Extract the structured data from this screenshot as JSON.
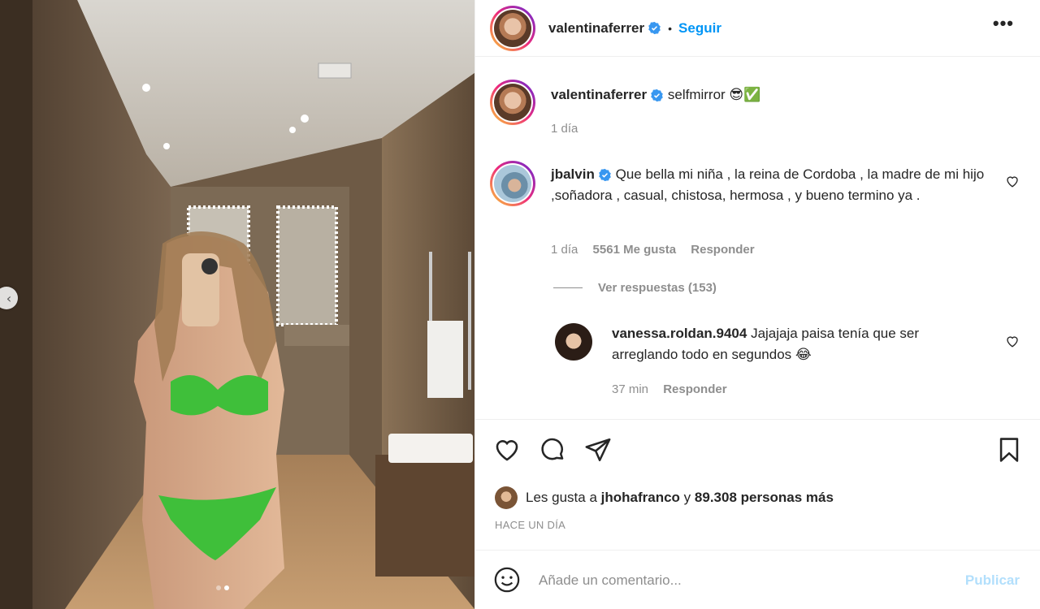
{
  "post": {
    "author": "valentinaferrer",
    "follow_label": "Seguir",
    "separator": "•",
    "more_label": "•••",
    "carousel_prev": "‹"
  },
  "caption": {
    "username": "valentinaferrer",
    "text": "selfmirror 😎✅",
    "time": "1 día"
  },
  "comments": [
    {
      "username": "jbalvin",
      "text": "Que bella mi niña , la reina de Cordoba , la madre de mi hijo ,soñadora , casual, chistosa, hermosa , y bueno termino ya .",
      "time": "1 día",
      "likes": "5561 Me gusta",
      "reply": "Responder",
      "view_replies": "Ver respuestas (153)"
    }
  ],
  "replies": [
    {
      "username": "vanessa.roldan.9404",
      "text": "Jajajaja paisa tenía que ser arreglando todo en segundos 😂",
      "time": "37 min",
      "reply": "Responder"
    }
  ],
  "likes": {
    "prefix": "Les gusta a",
    "user": "jhohafranco",
    "conjunction": "y",
    "others": "89.308 personas más",
    "time_ago": "HACE UN DÍA"
  },
  "composer": {
    "placeholder": "Añade un comentario...",
    "publish_label": "Publicar"
  },
  "icons": {
    "like": "heart-icon",
    "comment": "comment-icon",
    "share": "paper-plane-icon",
    "save": "bookmark-icon",
    "emoji": "smiley-icon"
  },
  "colors": {
    "link_blue": "#0095f6",
    "publish_disabled": "#b2dffc",
    "verified_blue": "#3897f0",
    "muted": "#8e8e8e"
  }
}
